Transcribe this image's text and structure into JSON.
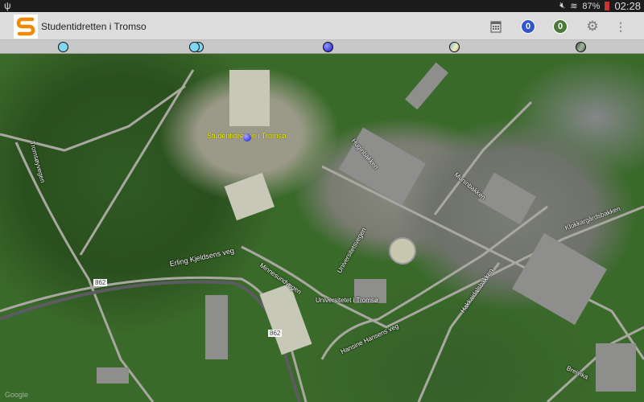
{
  "status_bar": {
    "battery": "87%",
    "time": "02:28",
    "icons": [
      "usb-icon",
      "mute-icon",
      "wifi-icon",
      "battery-icon"
    ]
  },
  "app_bar": {
    "title": "Studentidretten i Tromso",
    "logo_letter": "S",
    "calendar_icon": "calendar-icon",
    "badge_blue": "0",
    "badge_green": "0",
    "settings_icon": "gear-icon",
    "overflow_icon": "more-vert-icon",
    "colors": {
      "badge_blue": "#3355cc",
      "badge_green": "#4a7a3a",
      "logo": "#f08a00"
    }
  },
  "marker_strip": {
    "markers": [
      {
        "color": "#7fd8f0"
      },
      {
        "color": "#7fd8f0"
      },
      {
        "color": "#2020e0"
      },
      {
        "color": "#c8d8a0"
      },
      {
        "color": "#6a8a70"
      }
    ]
  },
  "map": {
    "pin_label": "Studentidretten i Tromsø",
    "labels": {
      "erling": "Erling Kjeldsens veg",
      "universitet": "Universitetet i Tromsø",
      "klokkar": "Klokkargårdsbakken",
      "hugin": "Huginbakken",
      "munin": "Muninbakken",
      "hansine": "Hansine Hansens veg",
      "breivika": "Breivika",
      "minnesund": "Minnesundvegen",
      "road862a": "862",
      "road862b": "862",
      "universitetsvegen": "Universitetsvegen",
      "hakkavika": "Hakkaidalsbakken",
      "tromsoya": "Tromsøyvegen"
    },
    "attribution": "Google"
  }
}
